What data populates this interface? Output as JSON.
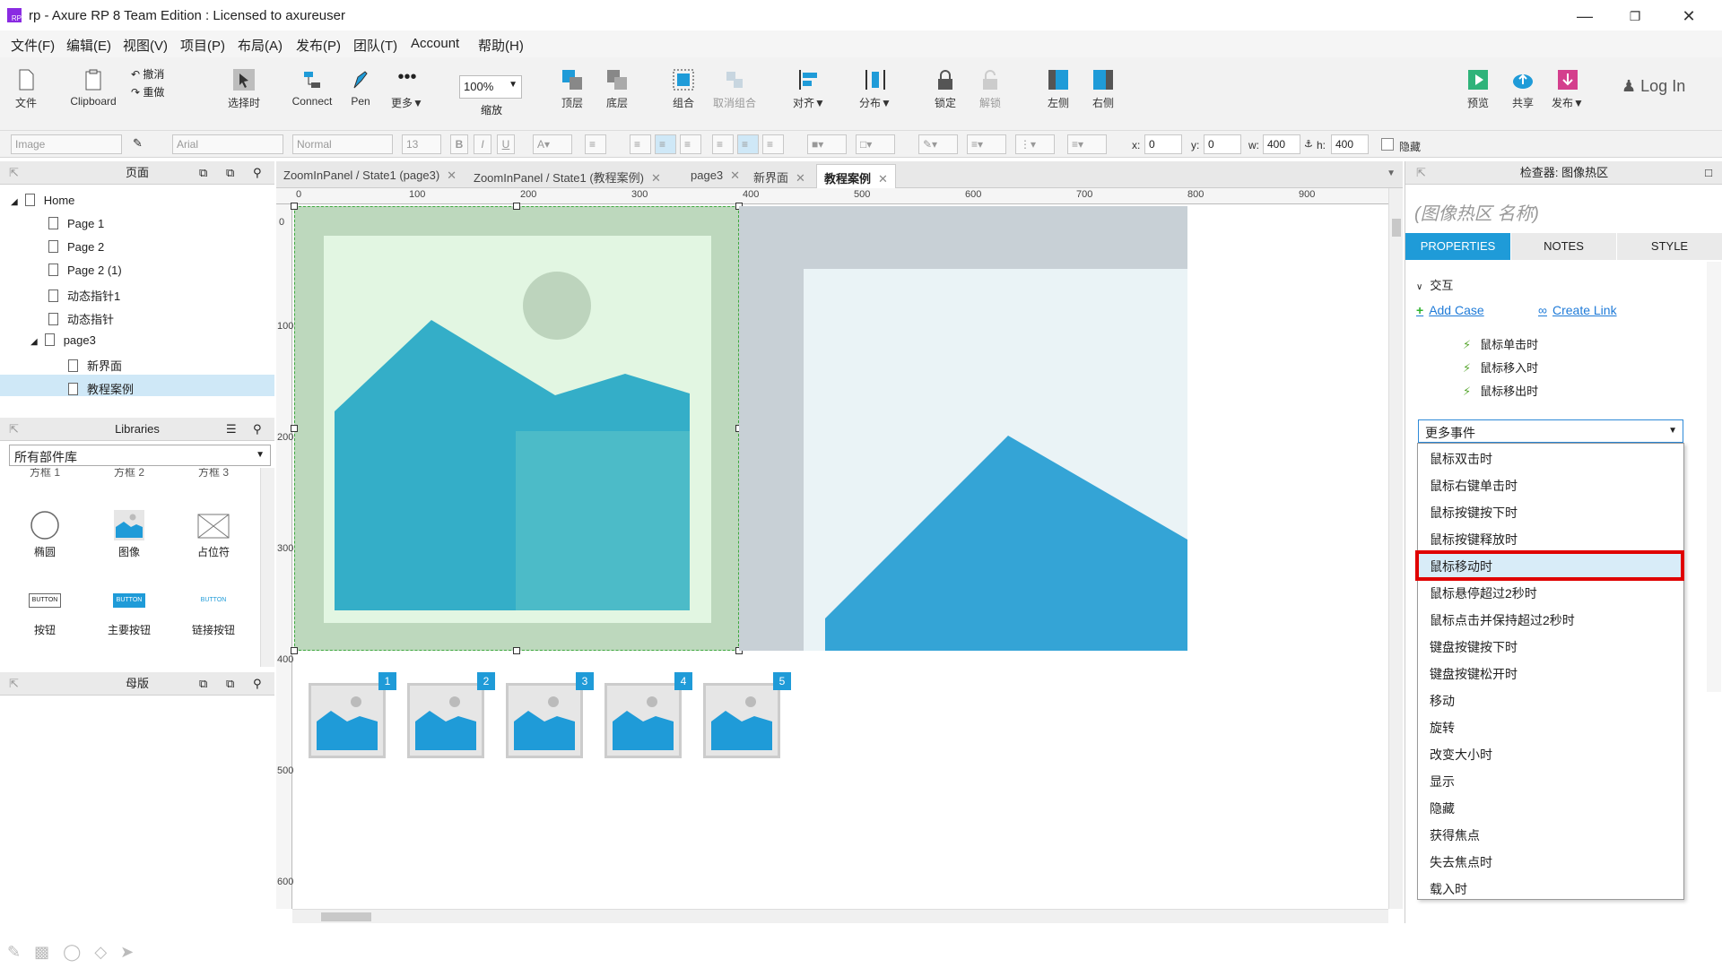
{
  "window": {
    "title": "rp - Axure RP 8 Team Edition : Licensed to axureuser",
    "logo_text": "RP"
  },
  "menu": [
    "文件(F)",
    "编辑(E)",
    "视图(V)",
    "项目(P)",
    "布局(A)",
    "发布(P)",
    "团队(T)",
    "Account",
    "帮助(H)"
  ],
  "toolbar": {
    "file": "文件",
    "clipboard": "Clipboard",
    "undo": "撤消",
    "redo": "重做",
    "select": "选择时",
    "connect": "Connect",
    "pen": "Pen",
    "more": "更多▼",
    "zoom_value": "100%",
    "zoom": "缩放",
    "top": "顶层",
    "bottom": "底层",
    "group": "组合",
    "ungroup": "取消组合",
    "align": "对齐▼",
    "distribute": "分布▼",
    "lock": "锁定",
    "unlock": "解锁",
    "left": "左侧",
    "right": "右侧",
    "preview": "预览",
    "share": "共享",
    "publish": "发布▼",
    "login": "Log In"
  },
  "format": {
    "style": "Image",
    "font": "Arial",
    "weight": "Normal",
    "size": "13",
    "x_label": "x:",
    "x_value": "0",
    "y_label": "y:",
    "y_value": "0",
    "w_label": "w:",
    "w_value": "400",
    "h_label": "h:",
    "h_value": "400",
    "hidden": "隐藏"
  },
  "pages_panel": {
    "title": "页面",
    "items": [
      "Home",
      "Page 1",
      "Page 2",
      "Page 2 (1)",
      "动态指针1",
      "动态指针",
      "page3",
      "新界面",
      "教程案例"
    ]
  },
  "libraries_panel": {
    "title": "Libraries",
    "selected": "所有部件库",
    "cut_labels": [
      "方框 1",
      "方框 2",
      "方框 3"
    ],
    "widgets": [
      "椭圆",
      "图像",
      "占位符",
      "按钮",
      "主要按钮",
      "链接按钮"
    ],
    "button_text": "BUTTON"
  },
  "masters_panel": {
    "title": "母版"
  },
  "tabs": [
    "ZoomInPanel / State1 (page3)",
    "ZoomInPanel / State1 (教程案例)",
    "page3",
    "新界面",
    "教程案例"
  ],
  "ruler": {
    "h": [
      "0",
      "100",
      "200",
      "300",
      "400",
      "500",
      "600",
      "700",
      "800",
      "900"
    ],
    "v": [
      "0",
      "100",
      "200",
      "300",
      "400",
      "500",
      "600"
    ]
  },
  "thumbnails": [
    "1",
    "2",
    "3",
    "4",
    "5"
  ],
  "inspector": {
    "title": "检查器: 图像热区",
    "name_placeholder": "(图像热区 名称)",
    "tabs": [
      "PROPERTIES",
      "NOTES",
      "STYLE"
    ],
    "section": "交互",
    "add_case": "Add Case",
    "create_link": "Create Link",
    "events": [
      "鼠标单击时",
      "鼠标移入时",
      "鼠标移出时"
    ],
    "more_events": "更多事件",
    "dropdown_items": [
      "鼠标双击时",
      "鼠标右键单击时",
      "鼠标按键按下时",
      "鼠标按键释放时",
      "鼠标移动时",
      "鼠标悬停超过2秒时",
      "鼠标点击并保持超过2秒时",
      "键盘按键按下时",
      "键盘按键松开时",
      "移动",
      "旋转",
      "改变大小时",
      "显示",
      "隐藏",
      "获得焦点",
      "失去焦点时",
      "载入时"
    ],
    "highlighted_item": "鼠标移动时"
  },
  "colors": {
    "accent_blue": "#1f9bd8",
    "tab_active": "#1f9bd8",
    "highlight_red": "#e00000",
    "selected_row": "#cfe8f7"
  }
}
